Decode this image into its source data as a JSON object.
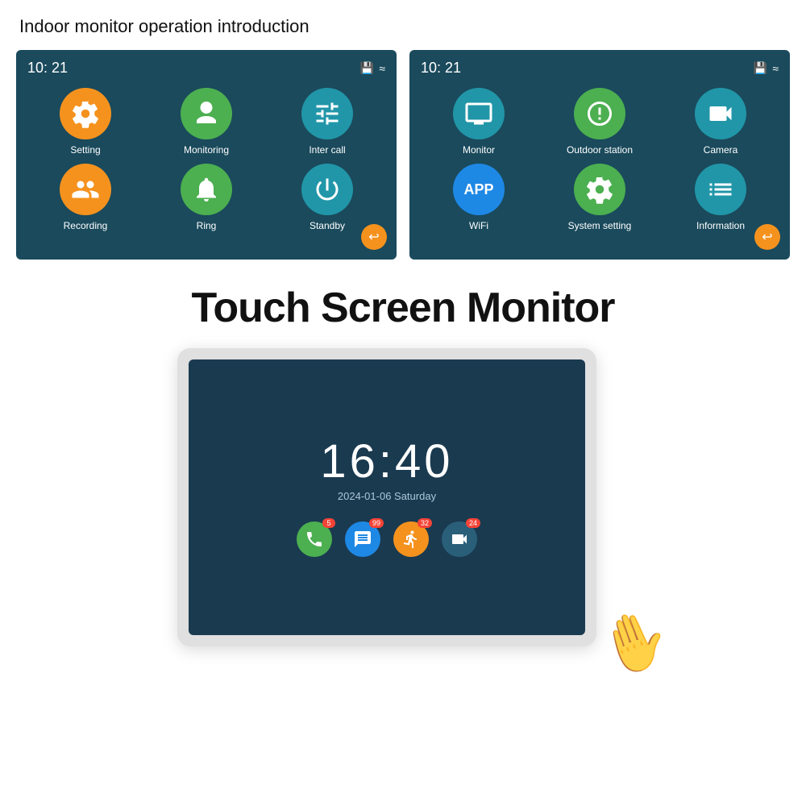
{
  "page": {
    "title": "Indoor monitor operation introduction",
    "touch_screen_title": "Touch Screen Monitor"
  },
  "screen1": {
    "time": "10: 21",
    "menu": [
      {
        "label": "Setting",
        "color": "orange",
        "icon": "gear"
      },
      {
        "label": "Monitoring",
        "color": "green",
        "icon": "camera-user"
      },
      {
        "label": "Inter call",
        "color": "teal",
        "icon": "equalizer"
      },
      {
        "label": "Recording",
        "color": "orange",
        "icon": "users"
      },
      {
        "label": "Ring",
        "color": "green",
        "icon": "bell"
      },
      {
        "label": "Standby",
        "color": "teal",
        "icon": "power"
      }
    ]
  },
  "screen2": {
    "time": "10: 21",
    "menu": [
      {
        "label": "Monitor",
        "color": "teal",
        "icon": "monitor"
      },
      {
        "label": "Outdoor station",
        "color": "green",
        "icon": "doorbell"
      },
      {
        "label": "Camera",
        "color": "teal",
        "icon": "cctv"
      },
      {
        "label": "WiFi",
        "color": "blue-accent",
        "icon": "app"
      },
      {
        "label": "System setting",
        "color": "green",
        "icon": "gear2"
      },
      {
        "label": "Information",
        "color": "teal",
        "icon": "list"
      }
    ]
  },
  "tablet": {
    "time": "16:40",
    "date": "2024-01-06  Saturday",
    "icons": [
      {
        "color": "#4caf50",
        "icon": "phone",
        "badge": "5"
      },
      {
        "color": "#1e88e5",
        "icon": "chat",
        "badge": "99"
      },
      {
        "color": "#f5921e",
        "icon": "person",
        "badge": "32"
      },
      {
        "color": "#1a4a5c",
        "icon": "video",
        "badge": "24"
      }
    ]
  }
}
